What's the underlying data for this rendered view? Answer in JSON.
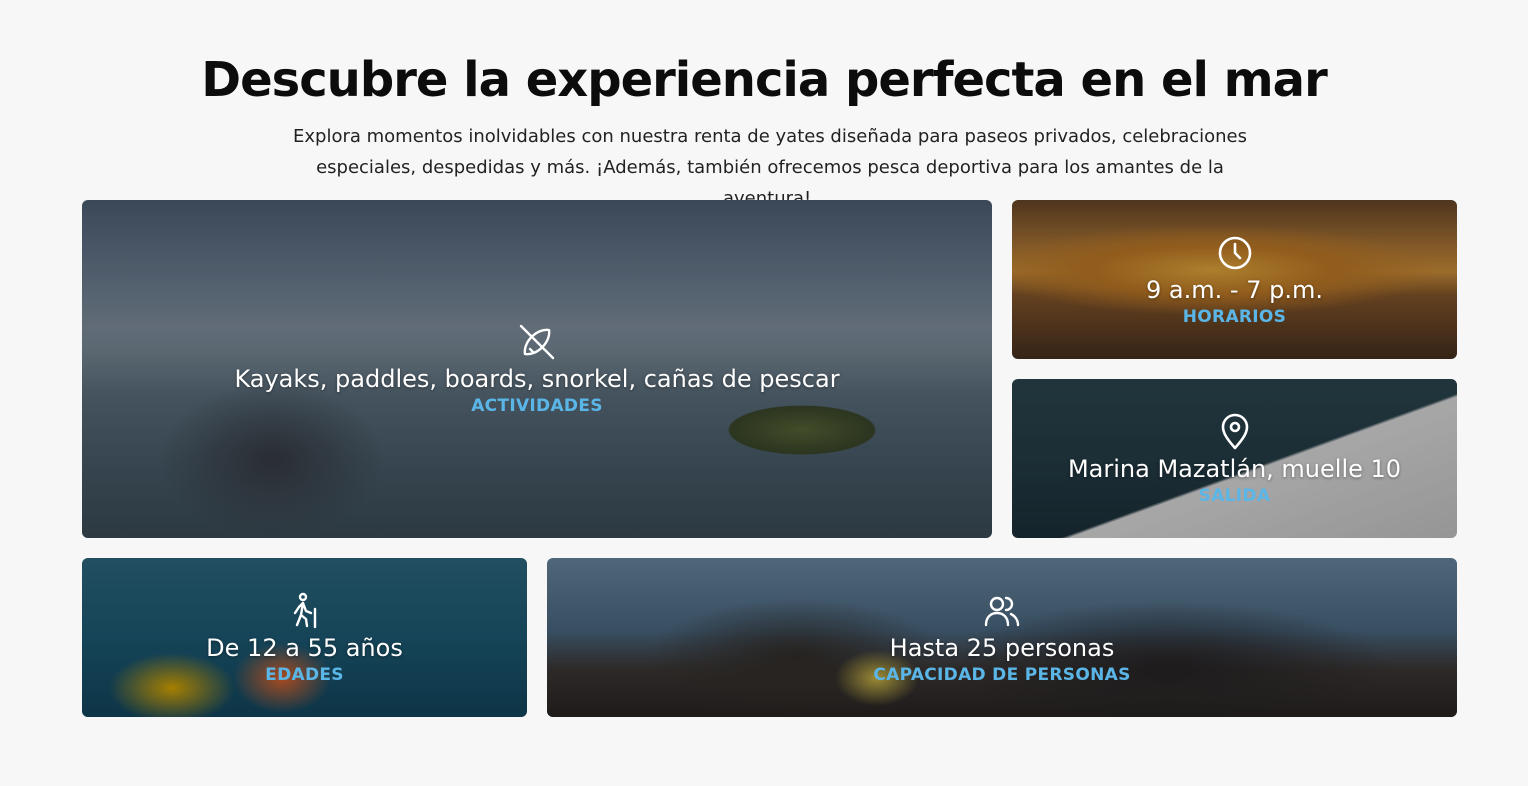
{
  "header": {
    "title": "Descubre la experiencia perfecta en el mar",
    "subtitle_line1": "Explora momentos inolvidables con nuestra renta de yates diseñada para paseos privados, celebraciones",
    "subtitle_line2": "especiales, despedidas y más. ¡Además, también ofrecemos pesca deportiva para los amantes de la aventura!."
  },
  "cards": {
    "actividades": {
      "icon": "kayak-icon",
      "value": "Kayaks, paddles, boards, snorkel, cañas de pescar",
      "label": "ACTIVIDADES"
    },
    "horarios": {
      "icon": "clock-icon",
      "value": "9 a.m. - 7 p.m.",
      "label": "HORARIOS"
    },
    "salida": {
      "icon": "map-pin-icon",
      "value": "Marina Mazatlán, muelle 10",
      "label": "SALIDA"
    },
    "edades": {
      "icon": "hiker-icon",
      "value": "De 12 a 55 años",
      "label": "EDADES"
    },
    "capacidad": {
      "icon": "users-icon",
      "value": "Hasta 25 personas",
      "label": "CAPACIDAD DE PERSONAS"
    }
  },
  "colors": {
    "accent": "#5bb6e8",
    "background": "#f7f7f7",
    "title": "#0c0c0c"
  }
}
